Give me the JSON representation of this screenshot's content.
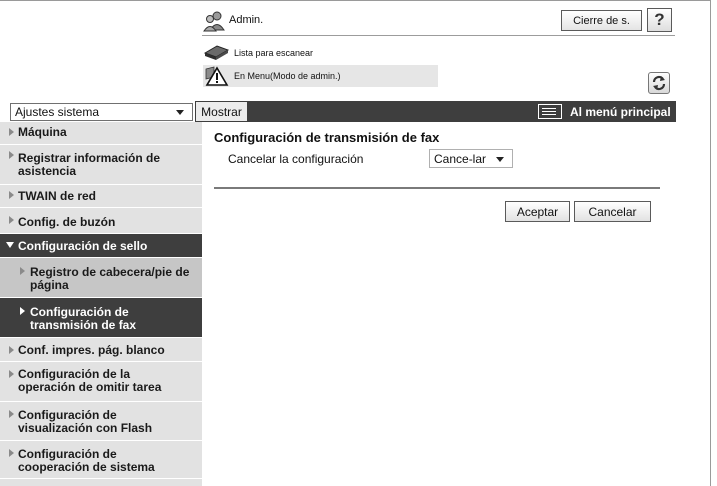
{
  "header": {
    "user_label": "Admin.",
    "logout_label": "Cierre de s.",
    "help_label": "?",
    "scan_status": "Lista para escanear",
    "mode_status": "En Menu(Modo de admin.)"
  },
  "toolbar": {
    "category_select_value": "Ajustes sistema",
    "show_tab_label": "Mostrar",
    "main_menu_label": "Al menú principal"
  },
  "sidebar": {
    "items": [
      {
        "label": "Máquina"
      },
      {
        "label": "Registrar información de asistencia"
      },
      {
        "label": "TWAIN de red"
      },
      {
        "label": "Config. de buzón"
      },
      {
        "label": "Configuración de sello"
      },
      {
        "label": "Registro de cabecera/pie de página"
      },
      {
        "label": "Configuración de transmisión de fax"
      },
      {
        "label": "Conf. impres. pág. blanco"
      },
      {
        "label": "Configuración de la operación de omitir tarea"
      },
      {
        "label": "Configuración de visualización con Flash"
      },
      {
        "label": "Configuración de cooperación de sistema"
      }
    ]
  },
  "main": {
    "title": "Configuración de transmisión de fax",
    "field_label": "Cancelar la configuración",
    "field_value": "Cance-lar",
    "ok_label": "Aceptar",
    "cancel_label": "Cancelar"
  },
  "icons": {
    "admin": "admin-users-icon",
    "scanner": "scanner-icon",
    "warning": "warning-icon",
    "refresh": "refresh-icon",
    "menu": "menu-list-icon"
  },
  "colors": {
    "dark_bar": "#3e3e3e",
    "sidebar_bg": "#e2e2e2",
    "sub_item_bg": "#c6c6c6"
  }
}
